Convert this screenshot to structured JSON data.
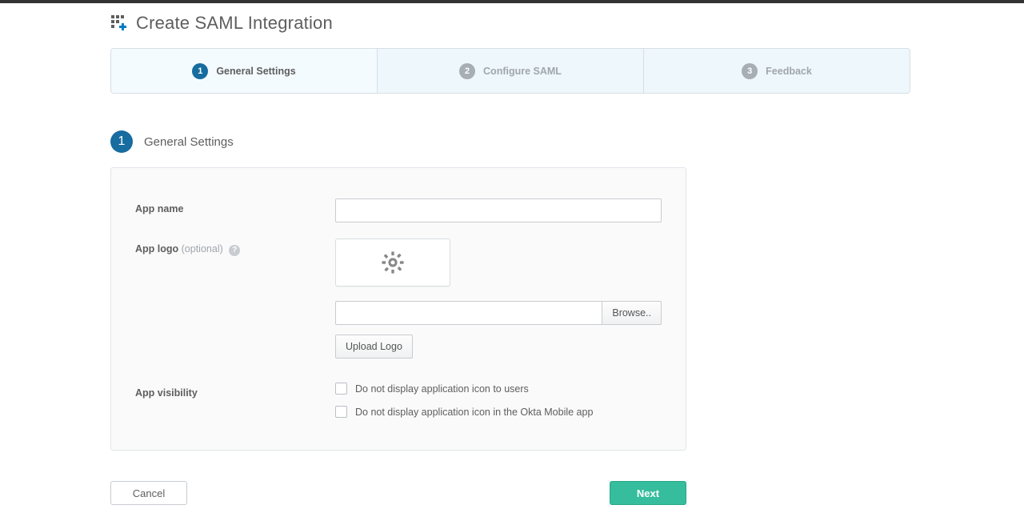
{
  "page_title": "Create SAML Integration",
  "steps": [
    {
      "num": "1",
      "label": "General Settings",
      "active": true
    },
    {
      "num": "2",
      "label": "Configure SAML",
      "active": false
    },
    {
      "num": "3",
      "label": "Feedback",
      "active": false
    }
  ],
  "section": {
    "num": "1",
    "title": "General Settings"
  },
  "form": {
    "app_name": {
      "label": "App name",
      "value": ""
    },
    "app_logo": {
      "label": "App logo",
      "optional": "(optional)",
      "browse": "Browse..",
      "upload": "Upload Logo"
    },
    "visibility": {
      "label": "App visibility",
      "opts": [
        "Do not display application icon to users",
        "Do not display application icon in the Okta Mobile app"
      ]
    }
  },
  "footer": {
    "cancel": "Cancel",
    "next": "Next"
  }
}
